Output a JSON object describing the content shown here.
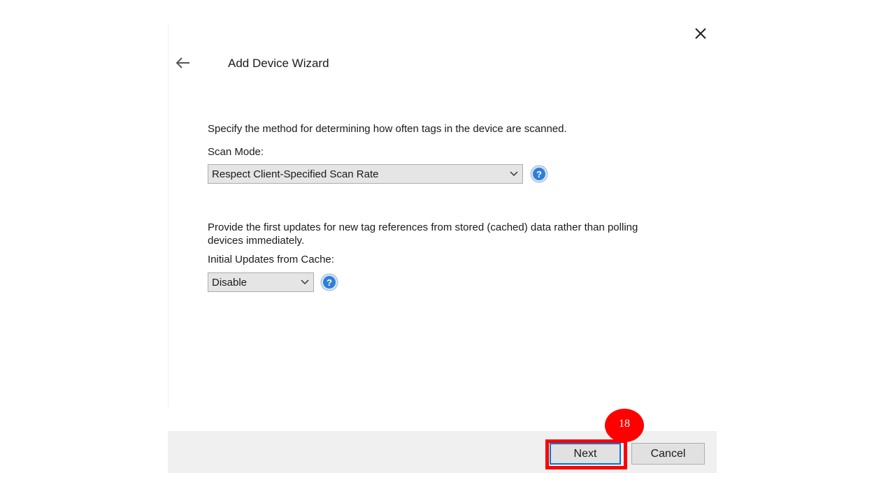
{
  "wizard": {
    "title": "Add Device Wizard"
  },
  "scan_section": {
    "description": "Specify the method for determining how often tags in the device are scanned.",
    "label": "Scan Mode:",
    "selected": "Respect Client-Specified Scan Rate"
  },
  "cache_section": {
    "description": "Provide the first updates for new tag references from stored (cached) data rather than polling devices immediately.",
    "label": "Initial Updates from Cache:",
    "selected": "Disable"
  },
  "buttons": {
    "next_label": "Next",
    "cancel_label": "Cancel"
  },
  "step_badge": {
    "number": "18"
  },
  "colors": {
    "highlight": "#ff0000",
    "help_icon": "#2f7fd8",
    "footer_bg": "#f0f0f0",
    "focus_border": "#0078d7"
  },
  "icons": {
    "close": "close-icon",
    "back": "back-arrow-icon",
    "help": "help-icon",
    "dropdown": "chevron-down-icon"
  }
}
